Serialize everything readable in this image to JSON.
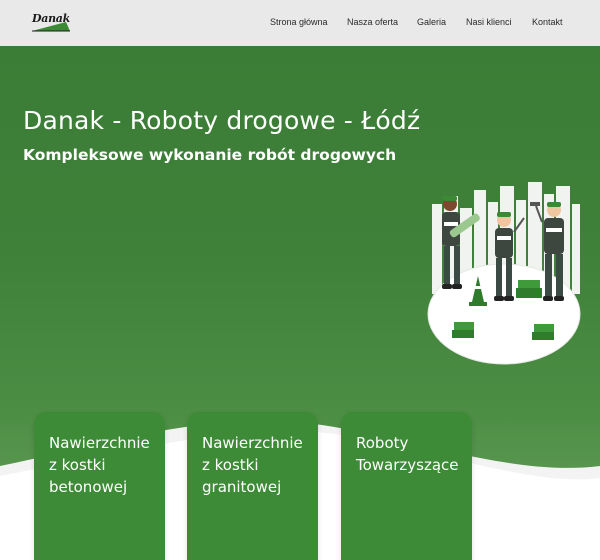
{
  "brand": {
    "logo_text": "Danak"
  },
  "nav": {
    "items": [
      {
        "label": "Strona główna"
      },
      {
        "label": "Nasza oferta"
      },
      {
        "label": "Galeria"
      },
      {
        "label": "Nasi klienci"
      },
      {
        "label": "Kontakt"
      }
    ]
  },
  "hero": {
    "title": "Danak - Roboty drogowe - Łódź",
    "subtitle": "Kompleksowe wykonanie robót drogowych",
    "illustration_icon": "road-workers-illustration"
  },
  "cards": [
    {
      "label": "Nawierzchnie\nz kostki\nbetonowej"
    },
    {
      "label": "Nawierzchnie\nz kostki\ngranitowej"
    },
    {
      "label": "Roboty\nTowarzyszące"
    }
  ],
  "colors": {
    "header_bg": "#e9e9e9",
    "hero_green": "#3f8139",
    "card_green": "#3d8b36",
    "text_white": "#ffffff"
  }
}
